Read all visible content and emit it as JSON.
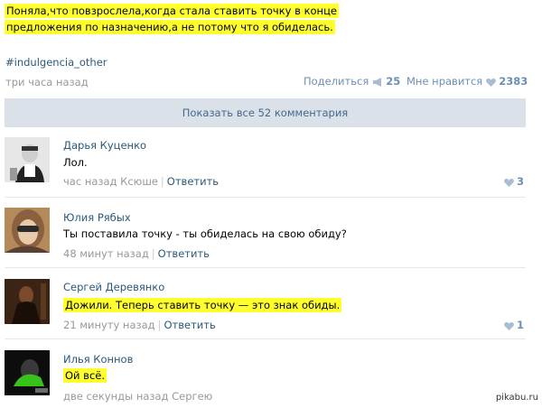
{
  "post": {
    "text": "Поняла,что повзрослела,когда стала ставить точку в конце предложения по назначению,а не потому что я обиделась.",
    "hashtag": "#indulgencia_other",
    "time": "три часа назад",
    "share_label": "Поделиться",
    "share_count": "25",
    "like_label": "Мне нравится",
    "like_count": "2383",
    "show_all_label": "Показать все 52 комментария"
  },
  "comments": [
    {
      "author": "Дарья Куценко",
      "text": "Лол.",
      "time": "час назад Ксюше",
      "reply": "Ответить",
      "likes": "3"
    },
    {
      "author": "Юлия Рябых",
      "text": "Ты поставила точку - ты обиделась на свою обиду?",
      "time": "48 минут назад",
      "reply": "Ответить",
      "likes": ""
    },
    {
      "author": "Сергей Деревянко",
      "text": "Дожили. Теперь ставить точку — это знак обиды.",
      "time": "21 минуту назад",
      "reply": "Ответить",
      "likes": "1"
    },
    {
      "author": "Илья Коннов",
      "text": "Ой всё.",
      "time": "две секунды назад Сергею",
      "reply": "",
      "likes": ""
    }
  ],
  "watermark": "pikabu.ru",
  "colors": {
    "highlight": "#ffff2e",
    "link": "#2b587a",
    "muted": "#999999",
    "button_bg": "#dae1e8",
    "accent": "#6d8fb3"
  }
}
